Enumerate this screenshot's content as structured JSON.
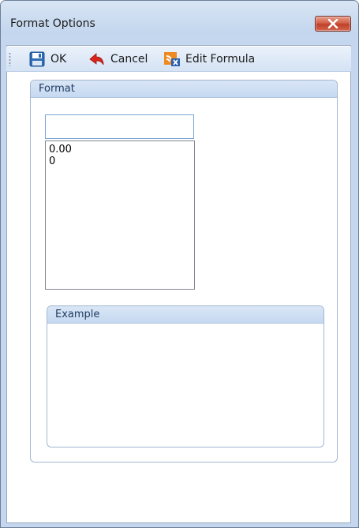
{
  "window": {
    "title": "Format Options",
    "close_icon": "close-icon",
    "colors": {
      "frame": "#c5d7ee",
      "close": "#c0402a",
      "header": "#c6d9f1"
    }
  },
  "toolbar": {
    "ok_label": "OK",
    "ok_icon": "save-icon",
    "cancel_label": "Cancel",
    "cancel_icon": "undo-arrow-icon",
    "edit_formula_label": "Edit Formula",
    "edit_formula_icon": "formula-icon"
  },
  "format_group": {
    "title": "Format",
    "input_value": "",
    "list_items": [
      "0.00",
      "0"
    ]
  },
  "example_group": {
    "title": "Example",
    "content": ""
  }
}
